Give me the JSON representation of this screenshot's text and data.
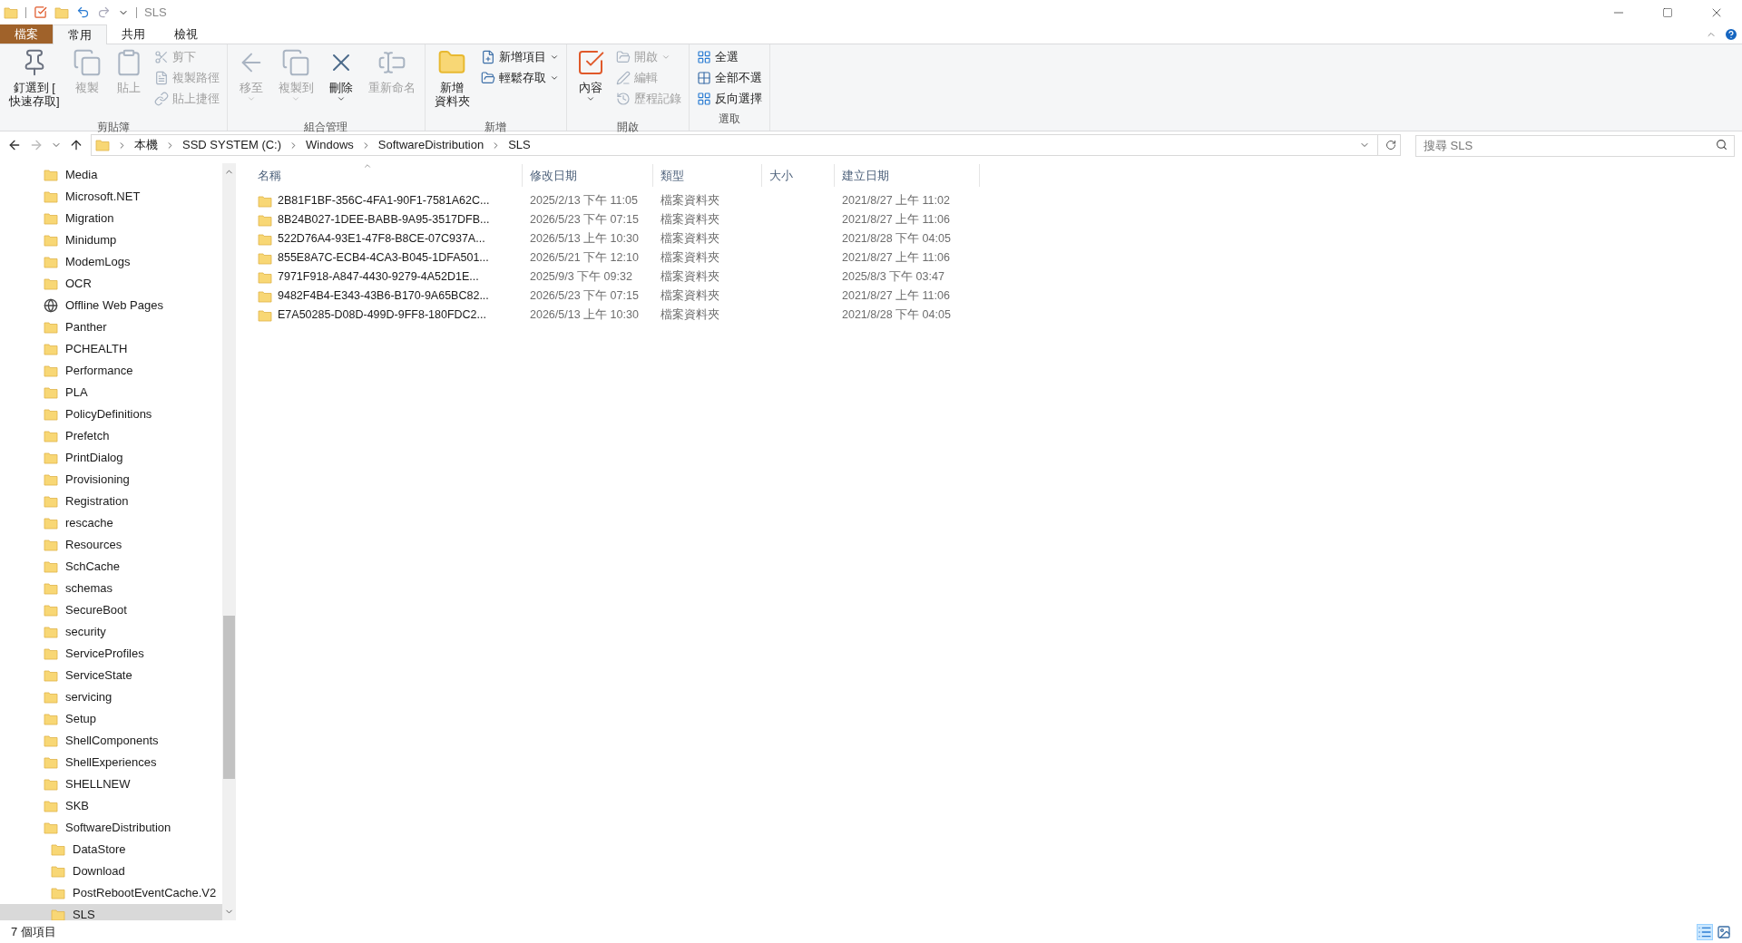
{
  "window": {
    "title": "SLS"
  },
  "ribbon_tabs": [
    {
      "label": "檔案",
      "kind": "file",
      "selected": false
    },
    {
      "label": "常用",
      "kind": "tab",
      "selected": true
    },
    {
      "label": "共用",
      "kind": "tab",
      "selected": false
    },
    {
      "label": "檢視",
      "kind": "tab",
      "selected": false
    }
  ],
  "ribbon_groups": [
    {
      "label": "剪貼簿",
      "items": [
        {
          "kind": "large",
          "lines": [
            "釘選到 [",
            "快速存取]"
          ],
          "disabled": false
        },
        {
          "kind": "large",
          "lines": [
            "複製"
          ],
          "disabled": true
        },
        {
          "kind": "large",
          "lines": [
            "貼上"
          ],
          "disabled": true
        },
        {
          "kind": "stack",
          "items": [
            {
              "label": "剪下",
              "disabled": true
            },
            {
              "label": "複製路徑",
              "disabled": true
            },
            {
              "label": "貼上捷徑",
              "disabled": true
            }
          ]
        }
      ]
    },
    {
      "label": "組合管理",
      "items": [
        {
          "kind": "large",
          "lines": [
            "移至"
          ],
          "disabled": true,
          "dropdown": true
        },
        {
          "kind": "large",
          "lines": [
            "複製到"
          ],
          "disabled": true,
          "dropdown": true
        },
        {
          "kind": "large",
          "lines": [
            "刪除"
          ],
          "disabled": false,
          "dropdown": true
        },
        {
          "kind": "large",
          "lines": [
            "重新命名"
          ],
          "disabled": true
        }
      ]
    },
    {
      "label": "新增",
      "items": [
        {
          "kind": "large",
          "lines": [
            "新增",
            "資料夾"
          ],
          "disabled": false
        },
        {
          "kind": "stack",
          "items": [
            {
              "label": "新增項目",
              "disabled": false,
              "dropdown": true
            },
            {
              "label": "輕鬆存取",
              "disabled": false,
              "dropdown": true
            }
          ]
        }
      ]
    },
    {
      "label": "開啟",
      "items": [
        {
          "kind": "large",
          "lines": [
            "內容"
          ],
          "disabled": false,
          "dropdown": true
        },
        {
          "kind": "stack",
          "items": [
            {
              "label": "開啟",
              "disabled": true,
              "dropdown": true
            },
            {
              "label": "編輯",
              "disabled": true
            },
            {
              "label": "歷程記錄",
              "disabled": true
            }
          ]
        }
      ]
    },
    {
      "label": "選取",
      "items": [
        {
          "kind": "stack",
          "items": [
            {
              "label": "全選",
              "disabled": false
            },
            {
              "label": "全部不選",
              "disabled": false
            },
            {
              "label": "反向選擇",
              "disabled": false
            }
          ]
        }
      ]
    }
  ],
  "address_bar": {
    "path": [
      "本機",
      "SSD SYSTEM (C:)",
      "Windows",
      "SoftwareDistribution",
      "SLS"
    ]
  },
  "search": {
    "placeholder": "搜尋 SLS"
  },
  "sidebar": {
    "items": [
      {
        "label": "Media",
        "kind": "folder",
        "selected": false
      },
      {
        "label": "Microsoft.NET",
        "kind": "folder",
        "selected": false
      },
      {
        "label": "Migration",
        "kind": "folder",
        "selected": false
      },
      {
        "label": "Minidump",
        "kind": "folder",
        "selected": false
      },
      {
        "label": "ModemLogs",
        "kind": "folder",
        "selected": false
      },
      {
        "label": "OCR",
        "kind": "folder",
        "selected": false
      },
      {
        "label": "Offline Web Pages",
        "kind": "special",
        "selected": false
      },
      {
        "label": "Panther",
        "kind": "folder",
        "selected": false
      },
      {
        "label": "PCHEALTH",
        "kind": "folder",
        "selected": false
      },
      {
        "label": "Performance",
        "kind": "folder",
        "selected": false
      },
      {
        "label": "PLA",
        "kind": "folder",
        "selected": false
      },
      {
        "label": "PolicyDefinitions",
        "kind": "folder",
        "selected": false
      },
      {
        "label": "Prefetch",
        "kind": "folder",
        "selected": false
      },
      {
        "label": "PrintDialog",
        "kind": "folder",
        "selected": false
      },
      {
        "label": "Provisioning",
        "kind": "folder",
        "selected": false
      },
      {
        "label": "Registration",
        "kind": "folder",
        "selected": false
      },
      {
        "label": "rescache",
        "kind": "folder",
        "selected": false
      },
      {
        "label": "Resources",
        "kind": "folder",
        "selected": false
      },
      {
        "label": "SchCache",
        "kind": "folder",
        "selected": false
      },
      {
        "label": "schemas",
        "kind": "folder",
        "selected": false
      },
      {
        "label": "SecureBoot",
        "kind": "folder",
        "selected": false
      },
      {
        "label": "security",
        "kind": "folder",
        "selected": false
      },
      {
        "label": "ServiceProfiles",
        "kind": "folder",
        "selected": false
      },
      {
        "label": "ServiceState",
        "kind": "folder",
        "selected": false
      },
      {
        "label": "servicing",
        "kind": "folder",
        "selected": false
      },
      {
        "label": "Setup",
        "kind": "folder",
        "selected": false
      },
      {
        "label": "ShellComponents",
        "kind": "folder",
        "selected": false
      },
      {
        "label": "ShellExperiences",
        "kind": "folder",
        "selected": false
      },
      {
        "label": "SHELLNEW",
        "kind": "folder",
        "selected": false
      },
      {
        "label": "SKB",
        "kind": "folder",
        "selected": false
      },
      {
        "label": "SoftwareDistribution",
        "kind": "folder",
        "selected": false,
        "children": [
          {
            "label": "DataStore",
            "kind": "folder",
            "selected": false
          },
          {
            "label": "Download",
            "kind": "folder",
            "selected": false
          },
          {
            "label": "PostRebootEventCache.V2",
            "kind": "folder",
            "selected": false
          },
          {
            "label": "SLS",
            "kind": "folder",
            "selected": true
          }
        ]
      }
    ]
  },
  "table": {
    "columns": [
      "名稱",
      "修改日期",
      "類型",
      "大小",
      "建立日期"
    ],
    "rows": [
      [
        "2B81F1BF-356C-4FA1-90F1-7581A62C...",
        "2025/2/13 下午 11:05",
        "檔案資料夾",
        "",
        "2021/8/27 上午 11:02"
      ],
      [
        "8B24B027-1DEE-BABB-9A95-3517DFB...",
        "2026/5/23 下午 07:15",
        "檔案資料夾",
        "",
        "2021/8/27 上午 11:06"
      ],
      [
        "522D76A4-93E1-47F8-B8CE-07C937A...",
        "2026/5/13 上午 10:30",
        "檔案資料夾",
        "",
        "2021/8/28 下午 04:05"
      ],
      [
        "855E8A7C-ECB4-4CA3-B045-1DFA501...",
        "2026/5/21 下午 12:10",
        "檔案資料夾",
        "",
        "2021/8/27 上午 11:06"
      ],
      [
        "7971F918-A847-4430-9279-4A52D1E...",
        "2025/9/3 下午 09:32",
        "檔案資料夾",
        "",
        "2025/8/3 下午 03:47"
      ],
      [
        "9482F4B4-E343-43B6-B170-9A65BC82...",
        "2026/5/23 下午 07:15",
        "檔案資料夾",
        "",
        "2021/8/27 上午 11:06"
      ],
      [
        "E7A50285-D08D-499D-9FF8-180FDC2...",
        "2026/5/13 上午 10:30",
        "檔案資料夾",
        "",
        "2021/8/28 下午 04:05"
      ]
    ]
  },
  "status_bar": {
    "count": "7 個項目"
  }
}
